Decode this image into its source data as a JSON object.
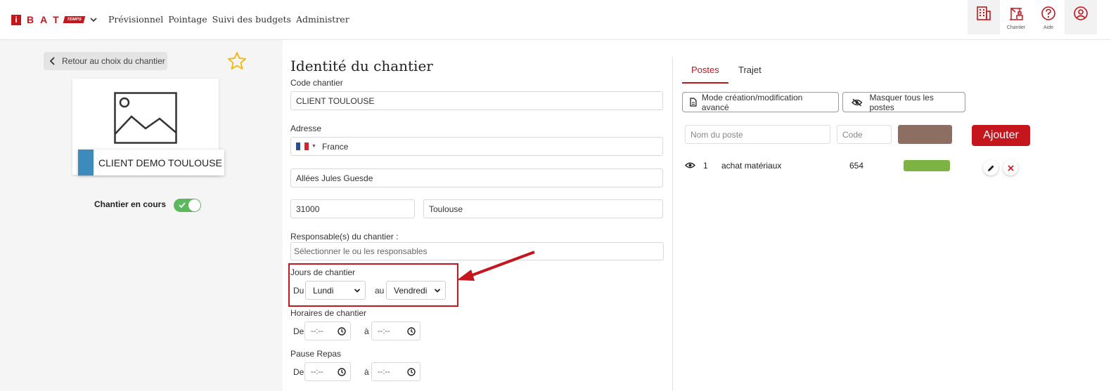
{
  "logo": {
    "i": "i",
    "bat": "BAT",
    "temps": "TEMPS"
  },
  "nav": [
    "Prévisionnel",
    "Pointage",
    "Suivi des budgets",
    "Administrer"
  ],
  "header_icons": [
    {
      "icon": "building-icon",
      "label": ""
    },
    {
      "icon": "crane-icon",
      "label": "Chantier"
    },
    {
      "icon": "help-icon",
      "label": "Aide"
    },
    {
      "icon": "user-icon",
      "label": ""
    }
  ],
  "left": {
    "back_label": "Retour au choix du chantier",
    "site_name": "CLIENT DEMO TOULOUSE I",
    "status_label": "Chantier en cours",
    "status_on": true
  },
  "form": {
    "title": "Identité du chantier",
    "code_label": "Code chantier",
    "code_value": "CLIENT TOULOUSE",
    "address_label": "Adresse",
    "country": "France",
    "street": "Allées Jules Guesde",
    "postal_code": "31000",
    "city": "Toulouse",
    "managers_label": "Responsable(s) du chantier :",
    "managers_placeholder": "Sélectionner le ou les responsables",
    "days_label": "Jours de chantier",
    "days_from_label": "Du",
    "days_from": "Lundi",
    "days_to_label": "au",
    "days_to": "Vendredi",
    "hours_label": "Horaires de chantier",
    "hours_from_label": "De",
    "hours_to_label": "à",
    "hours_from": "--:--",
    "hours_to": "--:--",
    "break_label": "Pause Repas",
    "break_from_label": "De",
    "break_to_label": "à",
    "break_from": "--:--",
    "break_to": "--:--"
  },
  "right": {
    "tabs": [
      "Postes",
      "Trajet"
    ],
    "active_tab": "Postes",
    "advanced_button": "Mode création/modification avancé",
    "hide_button": "Masquer tous les postes",
    "name_placeholder": "Nom du poste",
    "code_placeholder": "Code",
    "new_color": "#8d6e63",
    "add_button": "Ajouter",
    "postes": [
      {
        "index": "1",
        "name": "achat matériaux",
        "code": "654",
        "color": "#7cb342"
      }
    ]
  },
  "colors": {
    "accent": "#c4161c",
    "toggle_on": "#5cb85c",
    "site_tag": "#3d8bbd"
  }
}
